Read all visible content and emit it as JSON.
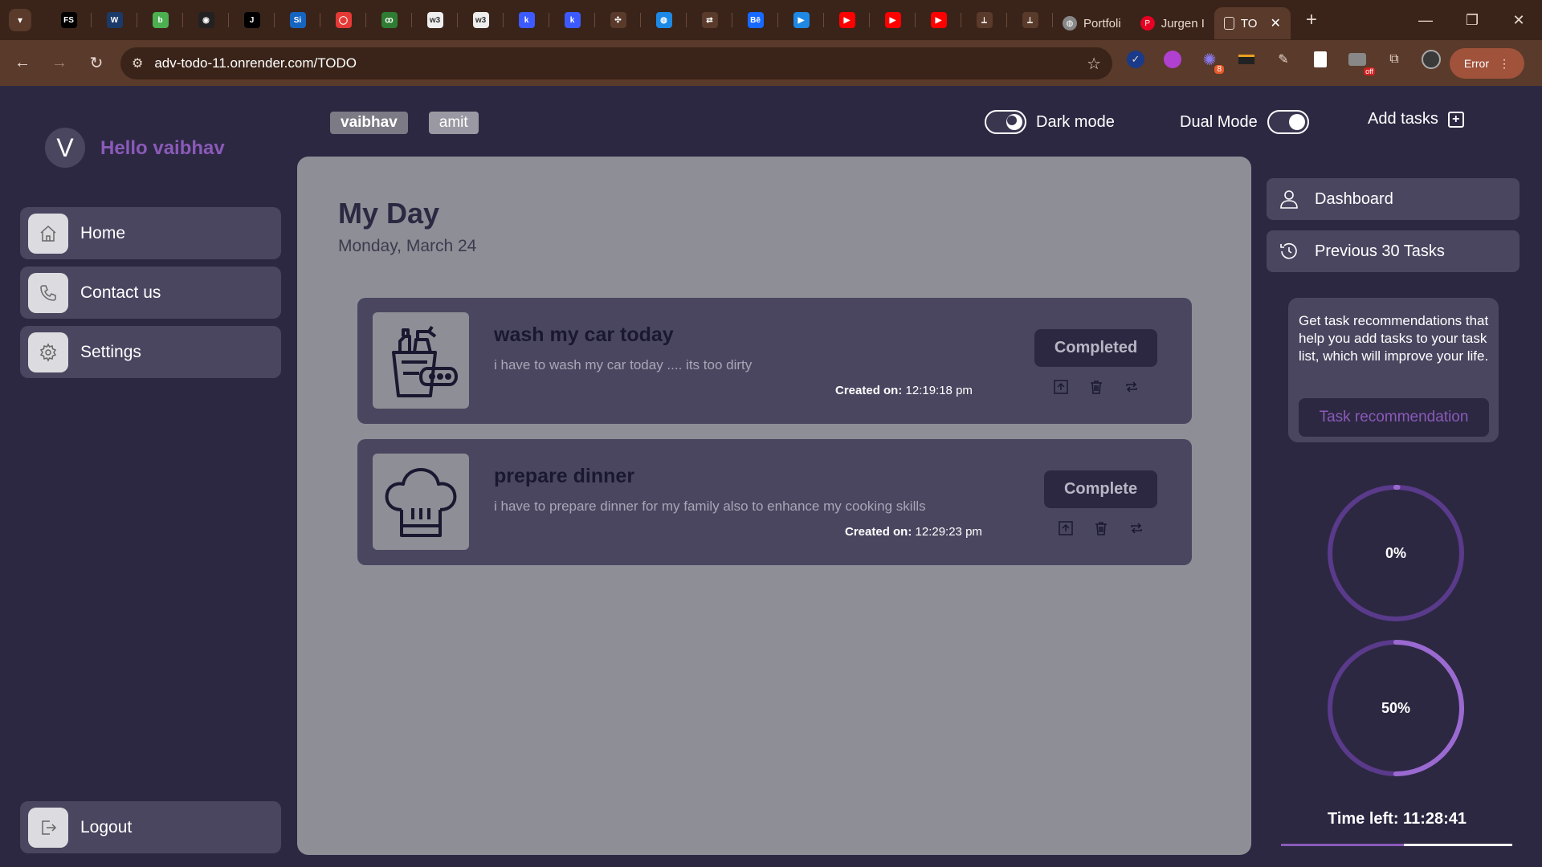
{
  "browser": {
    "url": "adv-todo-11.onrender.com/TODO",
    "pinned_tabs": [
      {
        "icon": "fs-icon",
        "label": "FS",
        "color": "#000000"
      },
      {
        "icon": "w-logo-icon",
        "label": "W",
        "color": "#1a3a6a"
      },
      {
        "icon": "leaf-icon",
        "label": "b",
        "color": "#4caf50"
      },
      {
        "icon": "clock-icon",
        "label": "◉",
        "color": "#222222"
      },
      {
        "icon": "j-icon",
        "label": "J",
        "color": "#000000"
      },
      {
        "icon": "si-icon",
        "label": "Si",
        "color": "#1565c0"
      },
      {
        "icon": "oracle-icon",
        "label": "◯",
        "color": "#e53935"
      },
      {
        "icon": "gfg-icon",
        "label": "ꝏ",
        "color": "#2e7d32"
      },
      {
        "icon": "w3-icon",
        "label": "w3",
        "color": "#eeeeee"
      },
      {
        "icon": "w3-icon",
        "label": "w3",
        "color": "#eeeeee"
      },
      {
        "icon": "k-icon",
        "label": "k",
        "color": "#3d5afe"
      },
      {
        "icon": "k-icon",
        "label": "k",
        "color": "#3d5afe"
      },
      {
        "icon": "network-icon",
        "label": "✣",
        "color": "#5a3a2a"
      },
      {
        "icon": "globe-icon",
        "label": "◍",
        "color": "#1e88e5"
      },
      {
        "icon": "arrow-icon",
        "label": "⇄",
        "color": "#5a3a2a"
      },
      {
        "icon": "behance-icon",
        "label": "Bē",
        "color": "#1769ff"
      },
      {
        "icon": "play-icon",
        "label": "▶",
        "color": "#1e88e5"
      },
      {
        "icon": "youtube-icon",
        "label": "▶",
        "color": "#ff0000"
      },
      {
        "icon": "youtube-icon",
        "label": "▶",
        "color": "#ff0000"
      },
      {
        "icon": "youtube-icon",
        "label": "▶",
        "color": "#ff0000"
      },
      {
        "icon": "tower-icon",
        "label": "⟂",
        "color": "#5a3a2a"
      },
      {
        "icon": "tower-icon",
        "label": "⟂",
        "color": "#5a3a2a"
      }
    ],
    "tabs": [
      {
        "label": "Portfoli",
        "icon": "globe-icon"
      },
      {
        "label": "Jurgen I",
        "icon": "pinterest-icon"
      },
      {
        "label": "TO",
        "icon": "doc-icon",
        "active": true
      }
    ],
    "extensions": [
      "check-icon",
      "puzzle-icon",
      "cursor-icon",
      "folder-icon",
      "pen-icon",
      "book-icon",
      "off-icon",
      "extensions-icon",
      "profile-icon"
    ],
    "ext_badge": "8",
    "off_badge": "off",
    "error_label": "Error"
  },
  "user": {
    "initial": "V",
    "greeting": "Hello vaibhav"
  },
  "sidebar": {
    "items": [
      {
        "label": "Home",
        "icon": "home-icon"
      },
      {
        "label": "Contact us",
        "icon": "phone-icon"
      },
      {
        "label": "Settings",
        "icon": "gear-icon"
      }
    ],
    "logout": "Logout"
  },
  "user_tabs": [
    "vaibhav",
    "amit"
  ],
  "header": {
    "dark_mode": "Dark mode",
    "dual_mode": "Dual Mode",
    "add_tasks": "Add tasks"
  },
  "main": {
    "title": "My Day",
    "date": "Monday, March 24",
    "tasks": [
      {
        "title": "wash my car today",
        "description": "i have to wash my car today .... its too dirty",
        "created_label": "Created on:",
        "created_time": "12:19:18 pm",
        "status": "Completed",
        "icon": "cleaning-supplies-icon"
      },
      {
        "title": "prepare dinner",
        "description": "i have to prepare dinner for my family also to enhance my cooking skills",
        "created_label": "Created on:",
        "created_time": "12:29:23 pm",
        "status": "Complete",
        "icon": "chef-hat-icon"
      }
    ]
  },
  "right": {
    "nav": [
      {
        "label": "Dashboard",
        "icon": "user-icon"
      },
      {
        "label": "Previous 30 Tasks",
        "icon": "history-icon"
      }
    ],
    "recommendation_text": "Get task recommendations that help you add tasks to your task list, which will improve your life.",
    "recommendation_button": "Task recommendation",
    "progress": [
      {
        "label": "0%",
        "value": 0
      },
      {
        "label": "50%",
        "value": 50
      }
    ],
    "time_left": "Time left: 11:28:41",
    "time_left_fraction": 0.53
  },
  "colors": {
    "accent": "#8a5ab8",
    "background": "#2c2842",
    "panel": "#4a4660",
    "main": "#8e8e96"
  }
}
